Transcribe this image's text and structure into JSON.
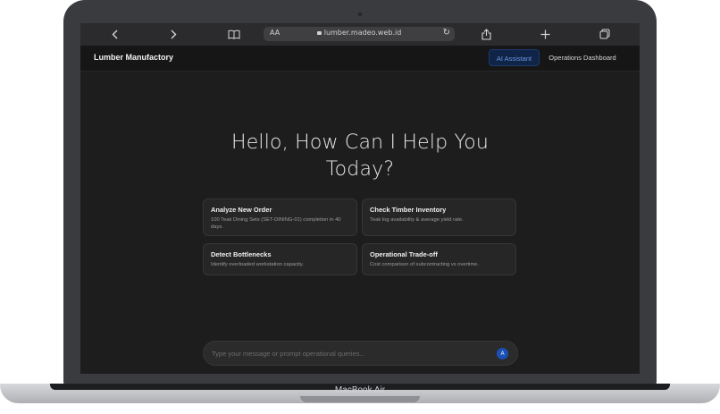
{
  "device": {
    "label": "MacBook Air"
  },
  "browser": {
    "text_size_label": "AA",
    "url": "lumber.madeo.web.id",
    "icons": [
      "chevron-left-icon",
      "chevron-right-icon",
      "book-icon",
      "lock-icon",
      "reload-icon",
      "share-icon",
      "plus-icon",
      "tabs-icon"
    ]
  },
  "app": {
    "brand": "Lumber Manufactory",
    "nav": [
      {
        "label": "AI Assistant",
        "active": true
      },
      {
        "label": "Operations Dashboard",
        "active": false
      }
    ]
  },
  "main": {
    "headline_line1": "Hello, How Can I Help You",
    "headline_line2": "Today?",
    "suggestions": [
      {
        "title": "Analyze New Order",
        "description": "100 Teak Dining Sets (SET-DINING-01) completion in 40 days."
      },
      {
        "title": "Check Timber Inventory",
        "description": "Teak log availability & average yield rate."
      },
      {
        "title": "Detect Bottlenecks",
        "description": "Identify overloaded workstation capacity."
      },
      {
        "title": "Operational Trade-off",
        "description": "Cost comparison of subcontracting vs overtime."
      }
    ],
    "prompt": {
      "placeholder": "Type your message or prompt operational queries...",
      "value": "",
      "send_glyph": "A"
    }
  },
  "colors": {
    "accent": "#1c4fb5",
    "active_nav_bg": "#102448",
    "active_nav_text": "#6d98dd",
    "page_bg": "#1d1d1d",
    "card_bg": "#262626"
  }
}
